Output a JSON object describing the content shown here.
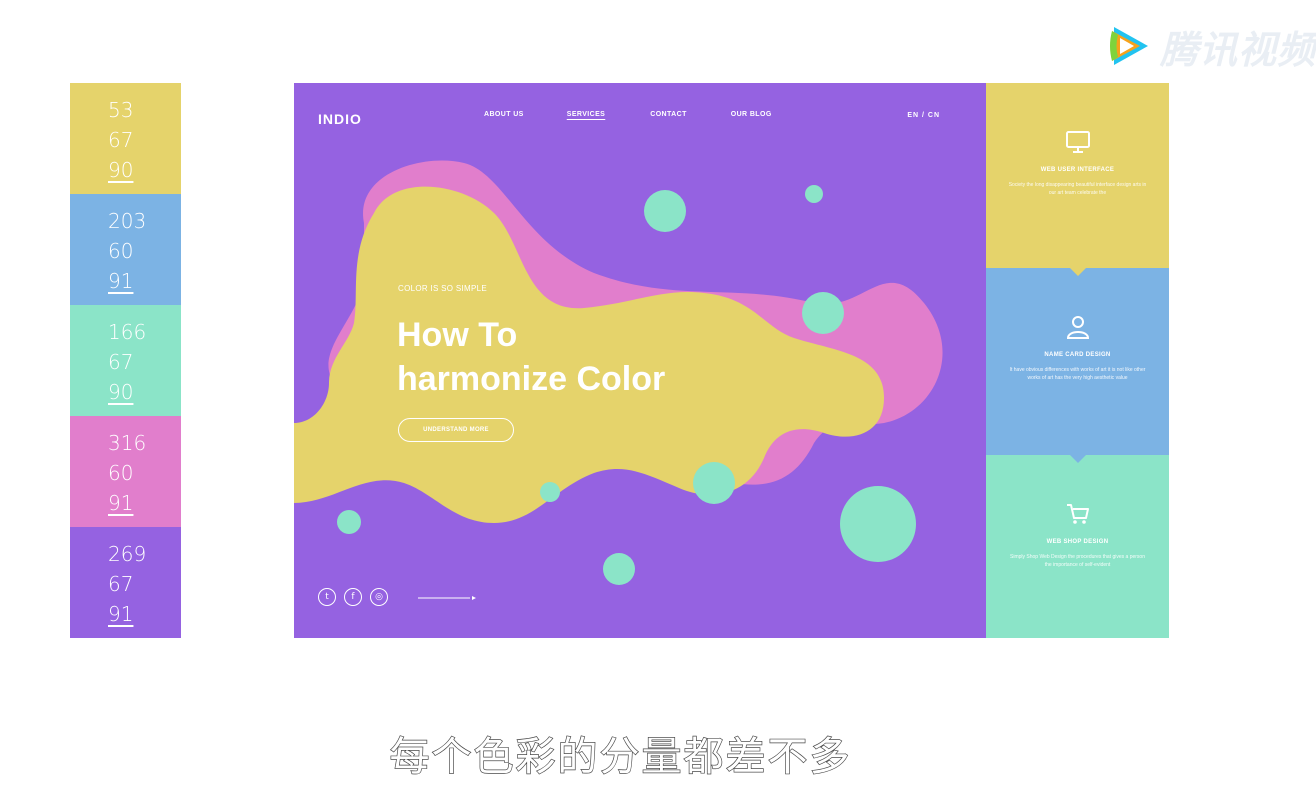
{
  "watermark": {
    "text": "腾讯视频",
    "logo_icon": "tencent-video-play-logo",
    "colors": [
      "#f7a21b",
      "#22c3f0",
      "#7fd33b"
    ]
  },
  "palette": {
    "swatches": [
      {
        "color": "#e5d36b",
        "values": [
          "53",
          "67",
          "90"
        ]
      },
      {
        "color": "#7cb3e4",
        "values": [
          "203",
          "60",
          "91"
        ]
      },
      {
        "color": "#8be4c8",
        "values": [
          "166",
          "67",
          "90"
        ]
      },
      {
        "color": "#e17ecc",
        "values": [
          "316",
          "60",
          "91"
        ]
      },
      {
        "color": "#9562e1",
        "values": [
          "269",
          "67",
          "91"
        ]
      }
    ]
  },
  "site": {
    "logo": "INDIO",
    "nav": [
      "ABOUT US",
      "SERVICES",
      "CONTACT",
      "OUR BLOG"
    ],
    "nav_active": "SERVICES",
    "lang": "EN / CN",
    "eyebrow": "COLOR IS SO SIMPLE",
    "headline_line1": "How To",
    "headline_line2": "harmonize Color",
    "cta": "UNDERSTAND MORE",
    "social_icons": [
      "twitter-icon",
      "facebook-icon",
      "instagram-icon"
    ],
    "colors": {
      "background": "#9562e1",
      "yellow": "#e5d36b",
      "pink": "#e17ecc",
      "mint": "#8be4c8",
      "blue": "#7cb3e4"
    }
  },
  "services": [
    {
      "icon": "monitor-icon",
      "title": "WEB USER INTERFACE",
      "desc": "Society the long disappearing beautiful interface design arts in our art team celebrate the",
      "color": "#e5d36b"
    },
    {
      "icon": "user-icon",
      "title": "NAME CARD DESIGN",
      "desc": "It have obvious differences with works of art it is not like other works of art has the very high aesthetic value",
      "color": "#7cb3e4"
    },
    {
      "icon": "cart-icon",
      "title": "WEB SHOP DESIGN",
      "desc": "Simply Shop Web Design the procedures that gives a person the importance of self-evident",
      "color": "#8be4c8"
    }
  ],
  "subtitle": "每个色彩的分量都差不多"
}
